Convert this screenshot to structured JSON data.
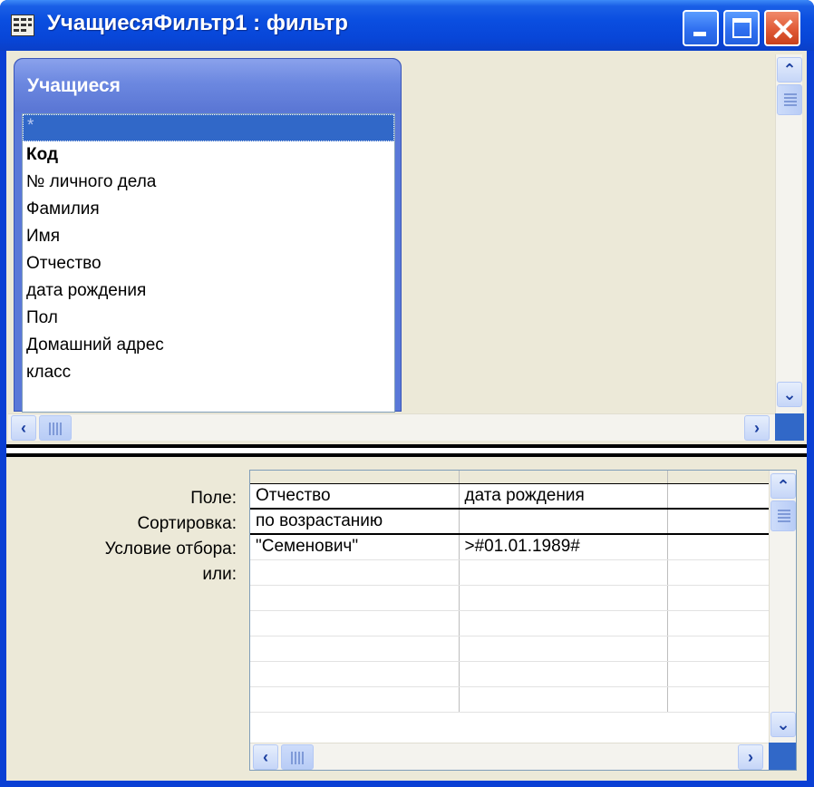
{
  "window": {
    "title": "УчащиесяФильтр1 : фильтр",
    "accent_color": "#0a4ee0",
    "close_color": "#e05a36"
  },
  "field_list": {
    "table_name": "Учащиеся",
    "fields": [
      "*",
      "Код",
      "№ личного дела",
      "Фамилия",
      "Имя",
      "Отчество",
      "дата рождения",
      "Пол",
      "Домашний адрес",
      "класс"
    ],
    "selected_field": "*",
    "primary_key_field": "Код"
  },
  "grid": {
    "row_labels": [
      "Поле:",
      "Сортировка:",
      "Условие отбора:",
      "или:"
    ],
    "columns": [
      {
        "field": "Отчество",
        "sort": "по возрастанию",
        "criteria": "\"Семенович\"",
        "or": ""
      },
      {
        "field": "дата рождения",
        "sort": "",
        "criteria": ">#01.01.1989#",
        "or": ""
      },
      {
        "field": "",
        "sort": "",
        "criteria": "",
        "or": ""
      }
    ]
  },
  "icons": {
    "app": "table-window-icon",
    "minimize": "minimize-icon",
    "maximize": "maximize-icon",
    "close": "close-icon",
    "scroll_up": "chevron-up-icon",
    "scroll_down": "chevron-down-icon",
    "scroll_left": "chevron-left-icon",
    "scroll_right": "chevron-right-icon"
  }
}
